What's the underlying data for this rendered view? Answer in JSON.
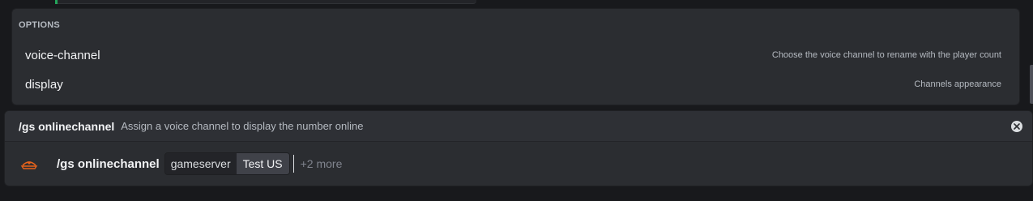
{
  "options": {
    "header": "OPTIONS",
    "items": [
      {
        "name": "voice-channel",
        "description": "Choose the voice channel to rename with the player count"
      },
      {
        "name": "display",
        "description": "Channels appearance"
      }
    ]
  },
  "command": {
    "name": "/gs onlinechannel",
    "description": "Assign a voice channel to display the number online",
    "close_icon": "close-circle-icon"
  },
  "input": {
    "avatar_icon": "bot-avatar-icon",
    "command_text": "/gs onlinechannel",
    "chip_name": "gameserver",
    "chip_value": "Test US",
    "more_text": "+2 more"
  },
  "colors": {
    "background": "#18191c",
    "panel": "#2b2d31",
    "accent_green": "#23a55a",
    "avatar_orange": "#e8631b"
  }
}
